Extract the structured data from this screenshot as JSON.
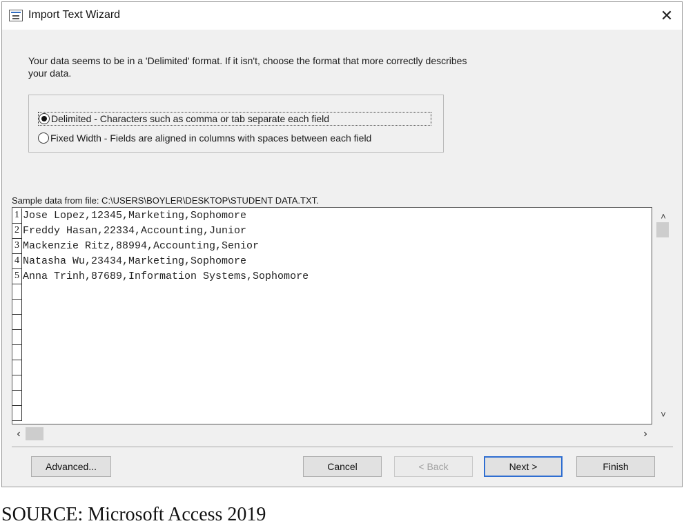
{
  "window": {
    "title": "Import Text Wizard",
    "close_glyph": "✕",
    "icon": "import-text-wizard-icon"
  },
  "intro_text": "Your data seems to be in a 'Delimited' format. If it isn't, choose the format that more correctly describes your data.",
  "format_options": [
    {
      "label": "Delimited - Characters such as comma or tab separate each field",
      "selected": true
    },
    {
      "label": "Fixed Width - Fields are aligned in columns with spaces between each field",
      "selected": false
    }
  ],
  "sample": {
    "label": "Sample data from file: C:\\USERS\\BOYLER\\DESKTOP\\STUDENT DATA.TXT.",
    "rows": [
      {
        "num": "1",
        "text": "Jose Lopez,12345,Marketing,Sophomore"
      },
      {
        "num": "2",
        "text": "Freddy Hasan,22334,Accounting,Junior"
      },
      {
        "num": "3",
        "text": "Mackenzie Ritz,88994,Accounting,Senior"
      },
      {
        "num": "4",
        "text": "Natasha Wu,23434,Marketing,Sophomore"
      },
      {
        "num": "5",
        "text": "Anna Trinh,87689,Information Systems,Sophomore"
      }
    ],
    "blank_rows": 9
  },
  "scroll": {
    "up": "˄",
    "down": "˅",
    "left": "‹",
    "right": "›"
  },
  "buttons": {
    "advanced": "Advanced...",
    "cancel": "Cancel",
    "back": "< Back",
    "next": "Next >",
    "finish": "Finish"
  },
  "source_caption": "SOURCE: Microsoft Access 2019",
  "colors": {
    "dialog_bg": "#f0f0f0",
    "default_button_border": "#2f6ed1"
  }
}
